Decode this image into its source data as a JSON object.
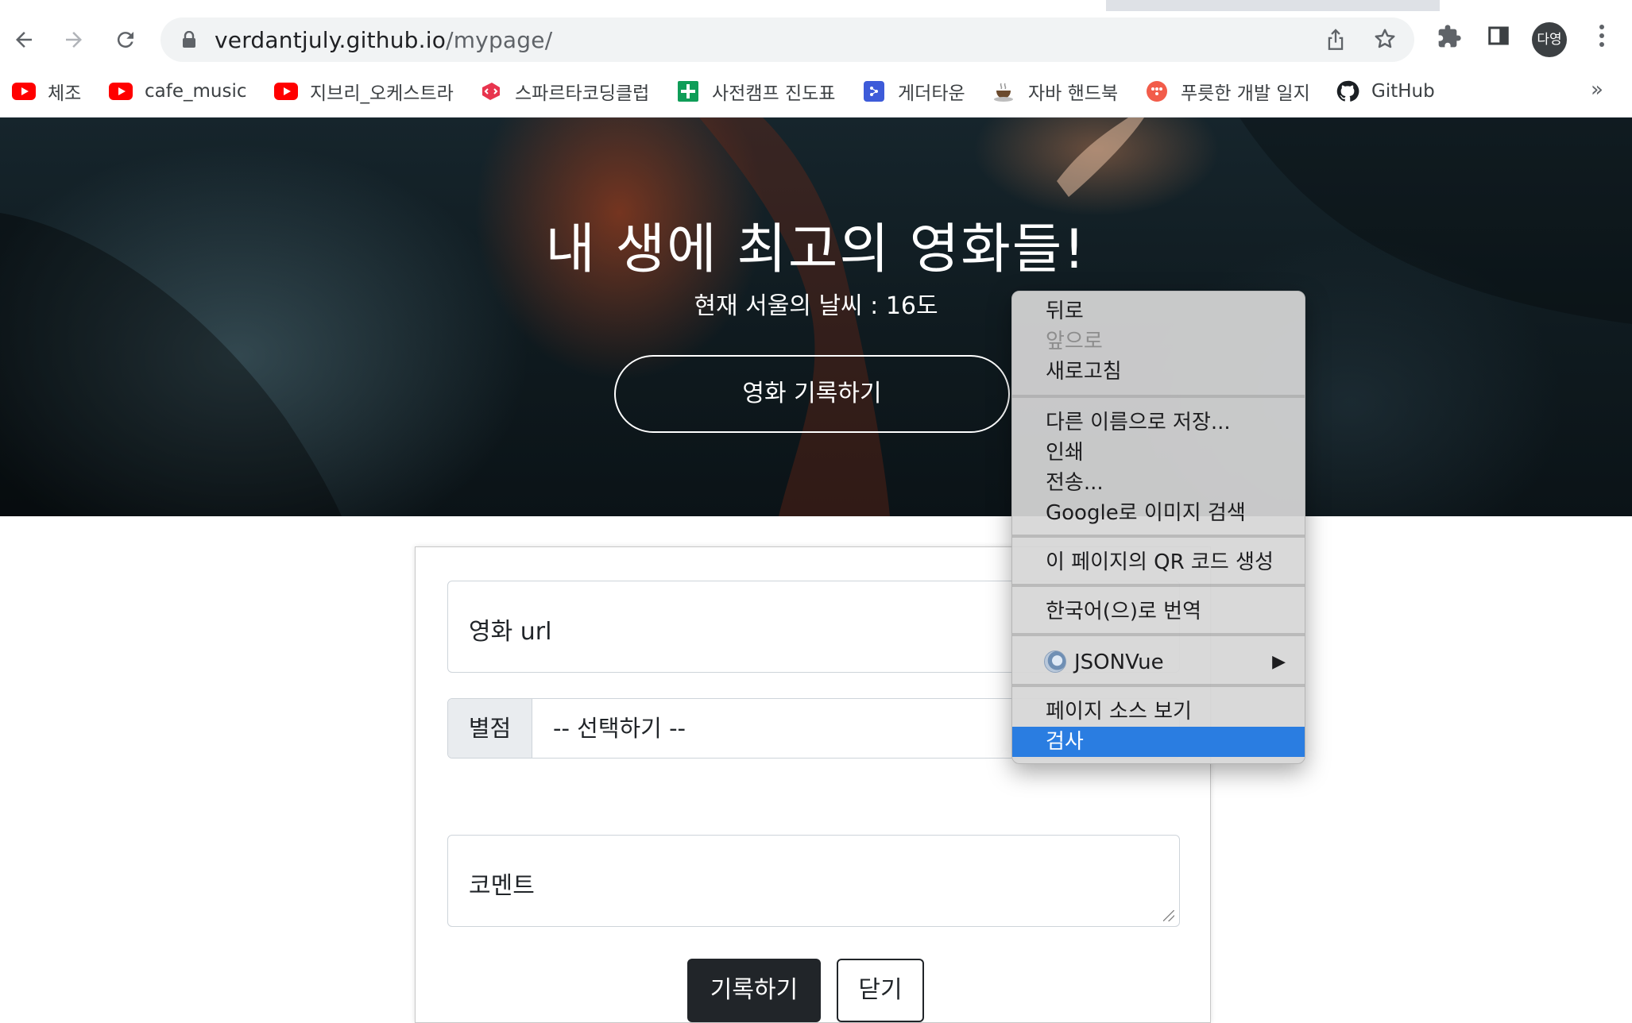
{
  "browser": {
    "url_host": "verdantjuly.github.io",
    "url_path": "/mypage/",
    "profile_initials": "다영",
    "icons": {
      "back": "arrow-left-icon",
      "forward": "arrow-right-icon",
      "reload": "reload-icon",
      "lock": "lock-icon",
      "share": "share-icon",
      "bookmark_star": "star-icon",
      "extensions": "puzzle-icon",
      "side_panel": "side-panel-icon",
      "menu": "kebab-menu-icon",
      "bookmarks_overflow": "double-chevron-icon"
    },
    "overflow_label": "»"
  },
  "bookmarks": [
    {
      "label": "체조",
      "icon": "youtube-icon"
    },
    {
      "label": "cafe_music",
      "icon": "youtube-icon"
    },
    {
      "label": "지브리_오케스트라",
      "icon": "youtube-icon"
    },
    {
      "label": "스파르타코딩클럽",
      "icon": "sparta-icon"
    },
    {
      "label": "사전캠프 진도표",
      "icon": "sheets-icon"
    },
    {
      "label": "게더타운",
      "icon": "gather-icon"
    },
    {
      "label": "자바 핸드북",
      "icon": "coffee-icon"
    },
    {
      "label": "푸릇한 개발 일지",
      "icon": "blog-icon"
    },
    {
      "label": "GitHub",
      "icon": "github-icon"
    }
  ],
  "hero": {
    "title": "내 생에 최고의 영화들!",
    "weather": "현재 서울의 날씨 : 16도",
    "record_button": "영화 기록하기"
  },
  "form": {
    "url_placeholder": "영화 url",
    "star_label": "별점",
    "star_select": "-- 선택하기 --",
    "comment_placeholder": "코멘트",
    "save_button": "기록하기",
    "close_button": "닫기"
  },
  "context_menu": {
    "back": "뒤로",
    "forward": "앞으로",
    "reload": "새로고침",
    "save_as": "다른 이름으로 저장...",
    "print": "인쇄",
    "send": "전송...",
    "google_image_search": "Google로 이미지 검색",
    "qr_code": "이 페이지의 QR 코드 생성",
    "translate": "한국어(으)로 번역",
    "jsonvue": "JSONVue",
    "view_source": "페이지 소스 보기",
    "inspect": "검사",
    "highlight_color": "#2a7de1"
  }
}
